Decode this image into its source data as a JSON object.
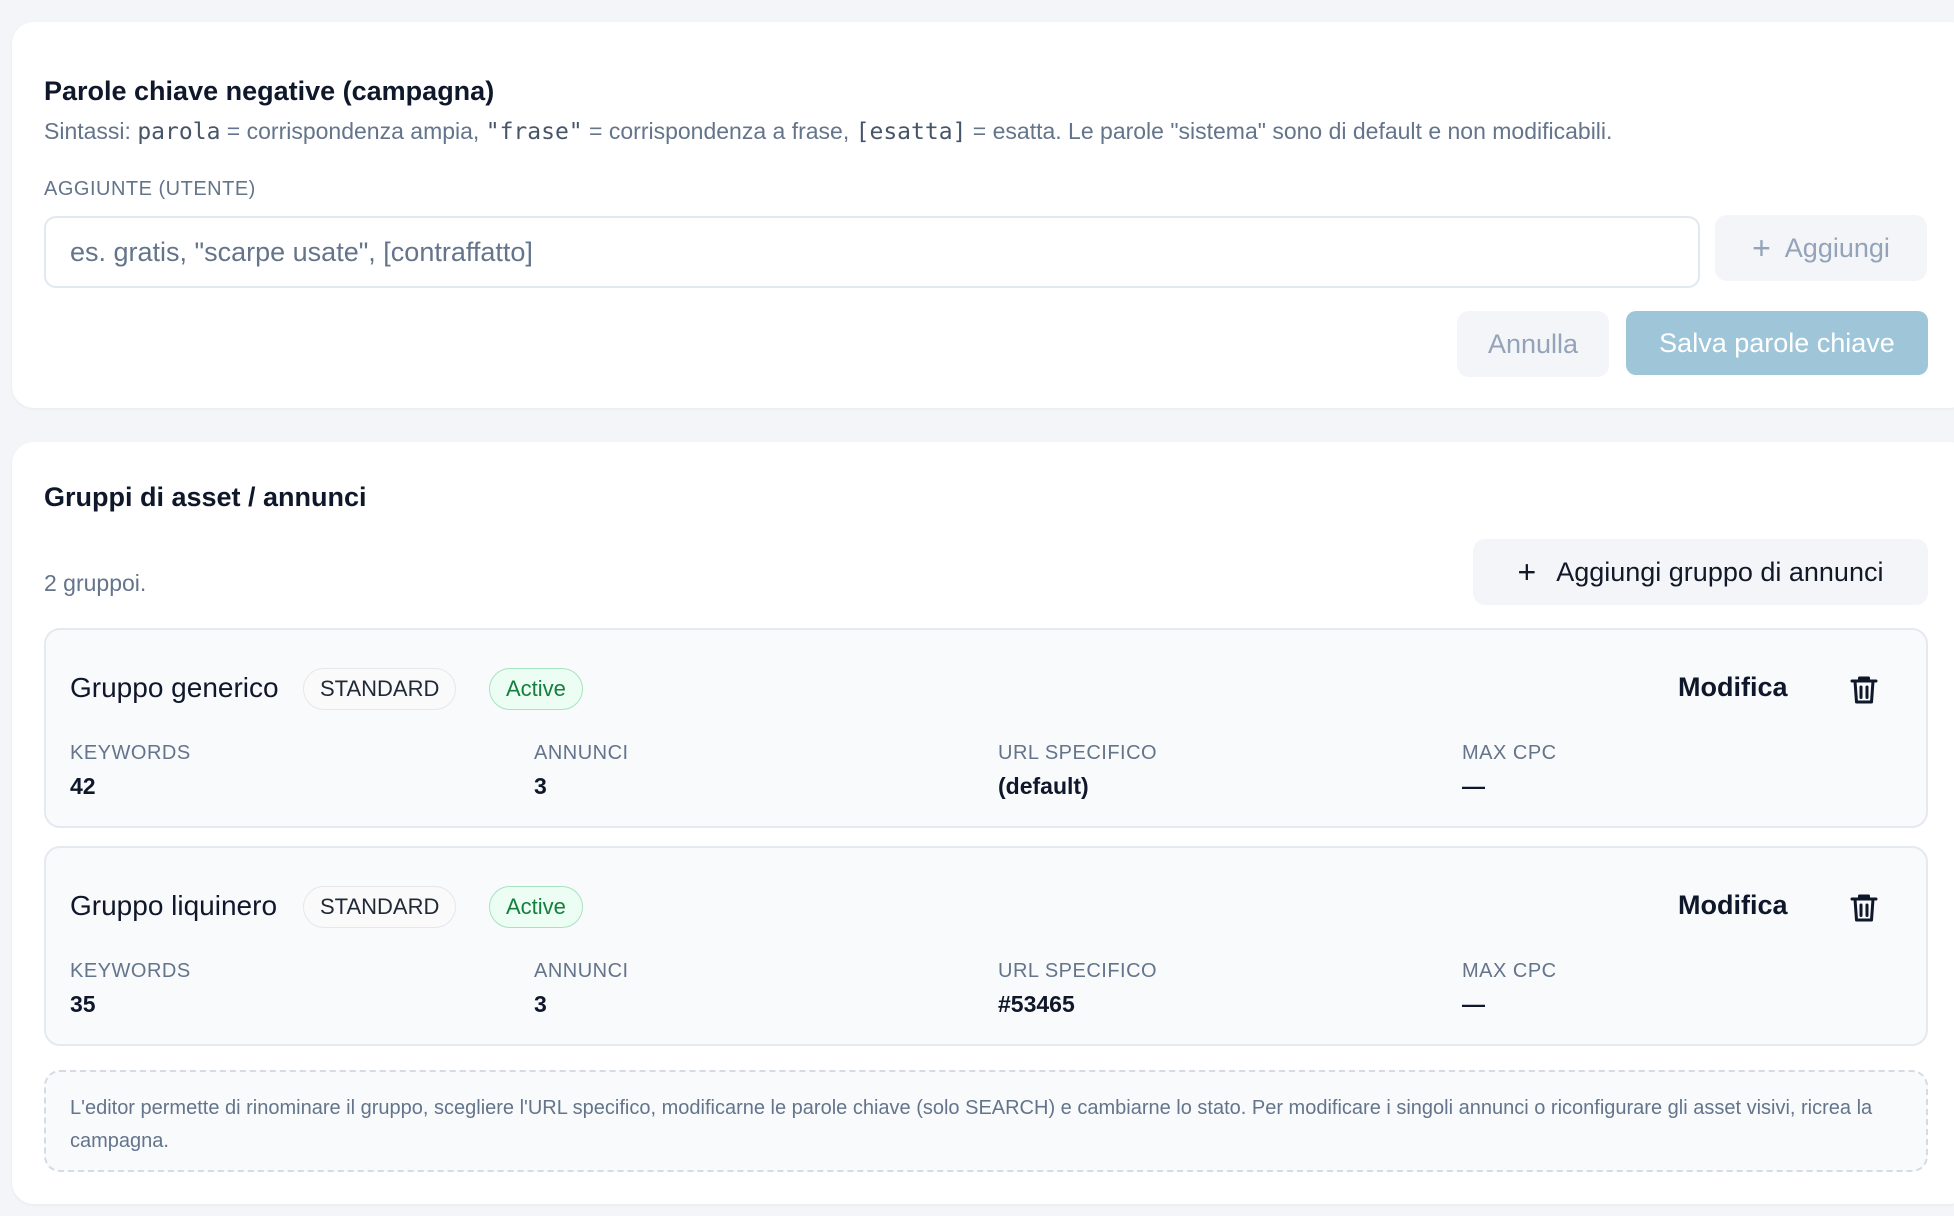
{
  "negative_keywords": {
    "title": "Parole chiave negative (campagna)",
    "syntax": {
      "prefix": "Sintassi: ",
      "broad_code": "parola",
      "broad_text": " = corrispondenza ampia, ",
      "phrase_code": "\"frase\"",
      "phrase_text": " = corrispondenza a frase, ",
      "exact_code": "[esatta]",
      "exact_text": " = esatta. Le parole \"sistema\" sono di default e non modificabili."
    },
    "field_label": "AGGIUNTE (UTENTE)",
    "input_value": "",
    "input_placeholder": "es. gratis, \"scarpe usate\", [contraffatto]",
    "add_label": "Aggiungi",
    "cancel_label": "Annulla",
    "save_label": "Salva parole chiave"
  },
  "groups_section": {
    "title": "Gruppi di asset / annunci",
    "summary": "2 gruppoi.",
    "add_group_label": "Aggiungi gruppo di annunci",
    "edit_label": "Modifica",
    "meta_labels": {
      "keywords": "KEYWORDS",
      "ads": "ANNUNCI",
      "url": "URL SPECIFICO",
      "max_cpc": "MAX CPC"
    },
    "groups": [
      {
        "name": "Gruppo generico",
        "type": "STANDARD",
        "status": "Active",
        "keywords": "42",
        "ads": "3",
        "url": "(default)",
        "max_cpc": "—"
      },
      {
        "name": "Gruppo liquinero",
        "type": "STANDARD",
        "status": "Active",
        "keywords": "35",
        "ads": "3",
        "url": "#53465",
        "max_cpc": "—"
      }
    ],
    "note": "L'editor permette di rinominare il gruppo, scegliere l'URL specifico, modificarne le parole chiave (solo SEARCH) e cambiarne lo stato. Per modificare i singoli annunci o riconfigurare gli asset visivi, ricrea la campagna."
  },
  "icons": {
    "add": "plus-icon",
    "delete": "trash-icon"
  },
  "colors": {
    "background": "#f3f5f8",
    "card": "#ffffff",
    "primary_disabled": "#9fc5d9",
    "status_active_text": "#15803d",
    "status_active_bg": "#ecfdf3",
    "status_active_border": "#a7e3c0",
    "muted_text": "#64748b"
  }
}
